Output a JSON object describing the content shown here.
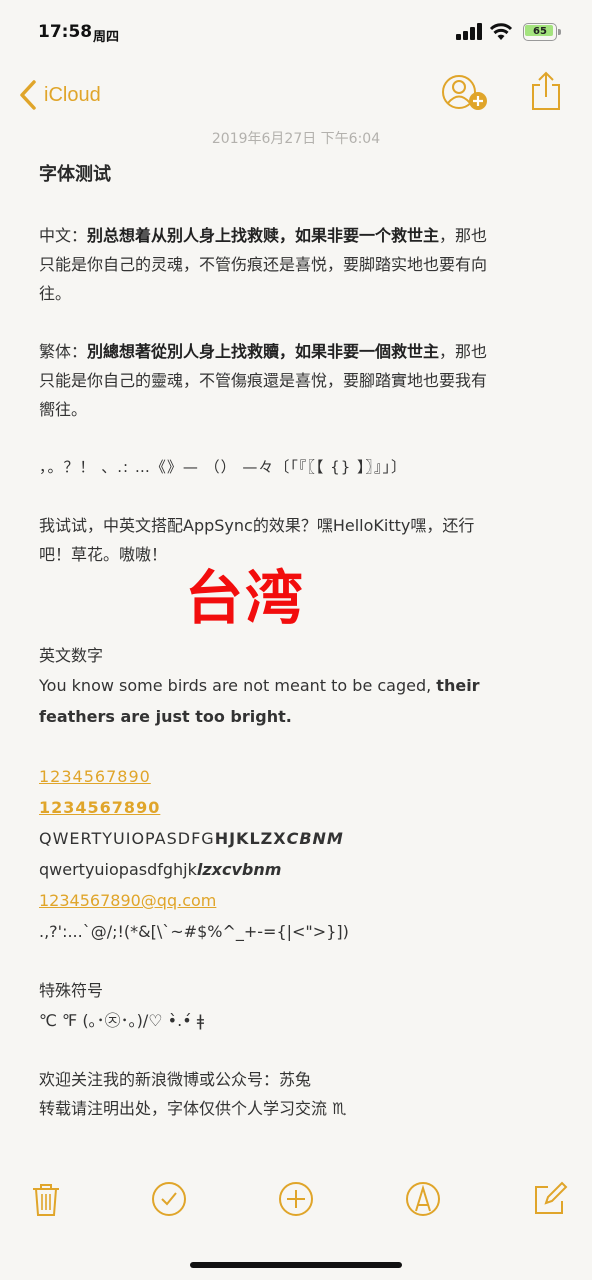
{
  "status": {
    "time": "17:58",
    "weekday": "周四",
    "battery": "65"
  },
  "nav": {
    "back_label": "iCloud"
  },
  "note": {
    "date": "2019年6月27日 下午6:04",
    "title": "字体测试",
    "simplified": {
      "label": "中文：",
      "bold": "别总想着从别人身上找救赎，如果非要一个救世主",
      "rest_line1": "，那也",
      "line2": "只能是你自己的灵魂，不管伤痕还是喜悦，要脚踏实地也要有向",
      "line3": "往。"
    },
    "traditional": {
      "label": "繁体：",
      "bold": "別總想著從別人身上找救贖，如果非要一個救世主",
      "rest_line1": "，那也",
      "line2": "只能是你自己的靈魂，不管傷痕還是喜悅，要腳踏實地也要我有",
      "line3": "嚮往。"
    },
    "punctuation": "，。？！ 、.:  …《》— （） —々〔「『〖【 {} 】〗』」〕",
    "mixed": {
      "line1": "我试试，中英文搭配AppSync的效果？嘿HelloKitty嘿，还行",
      "line2": "吧！草花。嗷嗷！"
    },
    "taiwan": "台湾",
    "english": {
      "heading": "英文数字",
      "sentence_normal": "You know some birds are not meant to be caged, ",
      "sentence_bold_1": "their",
      "sentence_bold_2": "feathers are just too bright."
    },
    "numbers_link": "1234567890",
    "numbers_link_bold": "1234567890",
    "upper_normal": "QWERTYUIOPASDFG",
    "upper_bold": "HJKLZX",
    "upper_bold_italic": "CBNM",
    "lower_normal": "qwertyuiopasdfghjk",
    "lower_bold_italic": "lzxcvbnm",
    "email": "1234567890@qq.com",
    "symbols": ".,?':...`@/;!(*&[\\`~#$%^_+-={|<\">}])",
    "special": {
      "heading": "特殊符号",
      "line": "℃  ℉ (｡･㉨･｡)/♡  •̀.•́ ǂ"
    },
    "footer": {
      "line1": "欢迎关注我的新浪微博或公众号：苏兔",
      "line2": "转载请注明出处，字体仅供个人学习交流 ♏"
    }
  },
  "colors": {
    "accent": "#e0a52a",
    "taiwan": "#f20d0d",
    "background": "#f7f6f3"
  }
}
